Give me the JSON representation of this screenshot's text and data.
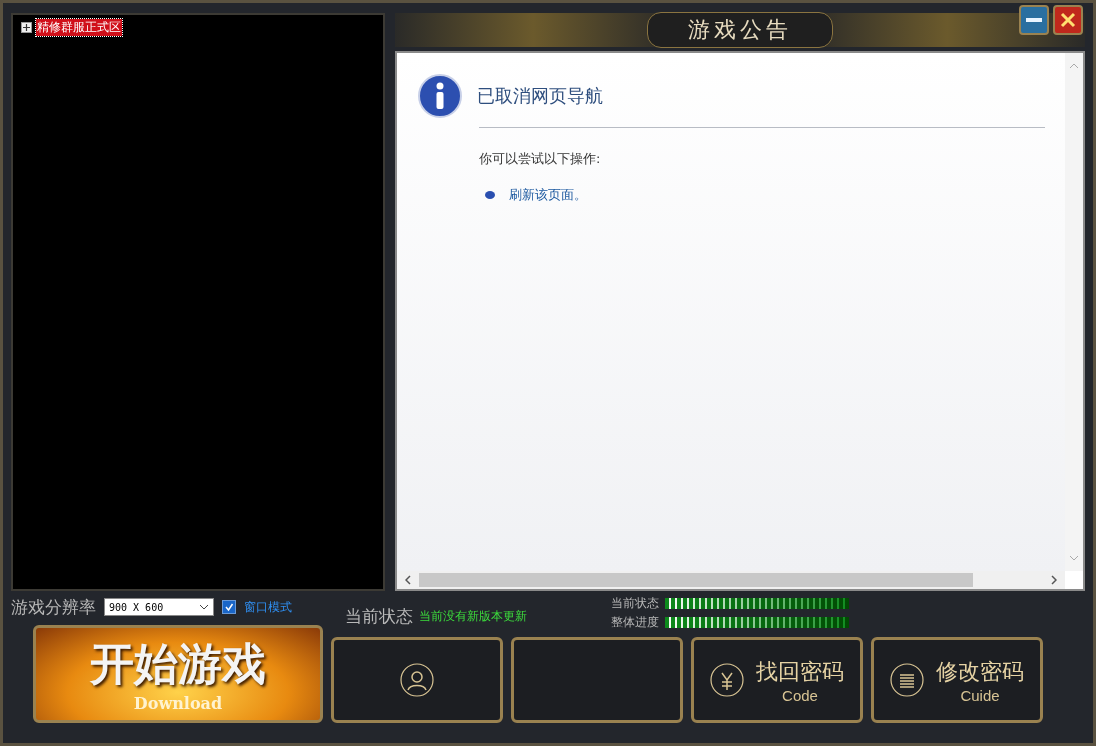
{
  "server_tree": {
    "items": [
      {
        "label": "精修群服正式区",
        "expanded": false,
        "selected": true
      }
    ]
  },
  "notice": {
    "title": "游戏公告",
    "page": {
      "heading": "已取消网页导航",
      "prompt": "你可以尝试以下操作:",
      "actions": [
        "刷新该页面。"
      ]
    }
  },
  "settings": {
    "resolution_label": "游戏分辨率",
    "resolution": "900 X 600",
    "window_mode": {
      "label": "窗口模式",
      "checked": true
    }
  },
  "status": {
    "label": "当前状态",
    "message": "当前没有新版本更新"
  },
  "progress": [
    {
      "label": "当前状态",
      "level": 1
    },
    {
      "label": "整体进度",
      "level": 1
    }
  ],
  "start_button": {
    "label": "开始游戏",
    "sub": "Download"
  },
  "buttons": [
    {
      "kind": "user"
    },
    {
      "kind": "none"
    },
    {
      "kind": "yen",
      "label": "找回密码",
      "sub": "Code"
    },
    {
      "kind": "list",
      "label": "修改密码",
      "sub": "Cuide"
    }
  ]
}
